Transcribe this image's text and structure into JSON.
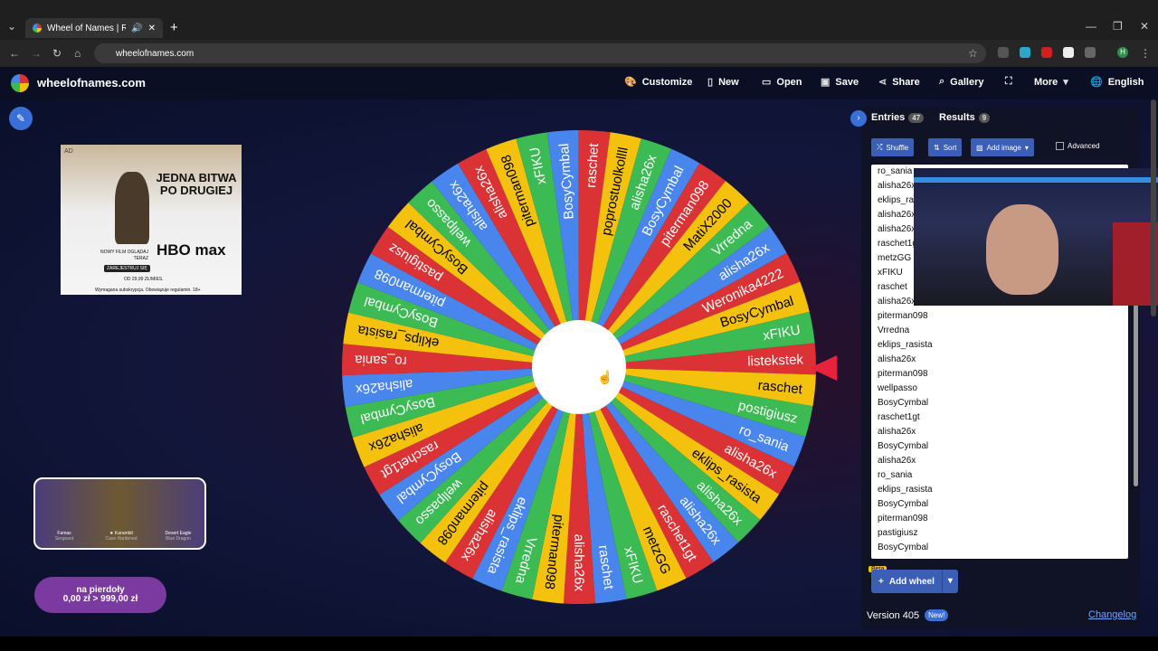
{
  "browser": {
    "tab_title": "Wheel of Names | Random",
    "new_tab_icon": "+",
    "url": "wheelofnames.com",
    "profile_initial": "H"
  },
  "site": {
    "name": "wheelofnames.com",
    "nav": {
      "customize": "Customize",
      "new": "New",
      "open": "Open",
      "save": "Save",
      "share": "Share",
      "gallery": "Gallery",
      "more": "More",
      "language": "English"
    }
  },
  "ad": {
    "label": "AD",
    "title": "JEDNA BITWA PO DRUGIEJ",
    "film_line": "NOWY FILM OGLĄDAJ TERAZ",
    "brand": "HBO max",
    "button": "ZAREJESTRUJ SIĘ",
    "price": "OD 29,99 ZŁ/MIES.",
    "footer": "Wymagana subskrypcja. Obowiązuje regulamin. 18+"
  },
  "skin_panel": {
    "items": [
      {
        "name": "Famas",
        "sub": "Sergeant"
      },
      {
        "name": "★ Karambit",
        "sub": "Case Hardened"
      },
      {
        "name": "Desert Eagle",
        "sub": "Blue Dragon"
      }
    ]
  },
  "price_box": {
    "line1": "na pierdoły",
    "line2": "0,00 zł > 999,00 zł"
  },
  "wheel": {
    "colors": [
      "#db3236",
      "#f4c20d",
      "#3cba54",
      "#4885ed"
    ],
    "winner_label": "listekstek",
    "segments": [
      "listekstek",
      "raschet",
      "postigiusz",
      "ro_sania",
      "alisha26x",
      "eklips_rasista",
      "alisha26x",
      "alisha26x",
      "raschet1gt",
      "metzGG",
      "xFIKU",
      "raschet",
      "alisha26x",
      "piterman098",
      "Vrredna",
      "eklips_rasista",
      "alisha26x",
      "piterman098",
      "wellpasso",
      "BosyCymbal",
      "raschet1gt",
      "alisha26x",
      "BosyCymbal",
      "alisha26x",
      "ro_sania",
      "eklips_rasista",
      "BosyCymbal",
      "piterman098",
      "pastigiusz",
      "BosyCymbal",
      "wellpasso",
      "alisha26x",
      "alisha26x",
      "piterman098",
      "xFIKU",
      "BosyCymbal",
      "raschet",
      "poprostuolkollll",
      "alisha26x",
      "BosyCymbal",
      "piterman098",
      "MatiX2000",
      "Vrredna",
      "alisha26x",
      "Weronika4222",
      "BosyCymbal",
      "xFIKU"
    ]
  },
  "panel": {
    "entries_tab": "Entries",
    "entries_count": "47",
    "results_tab": "Results",
    "results_count": "9",
    "shuffle": "Shuffle",
    "sort": "Sort",
    "add_image": "Add image",
    "advanced": "Advanced",
    "entries": [
      "ro_sania",
      "alisha26x",
      "eklips_rasista",
      "alisha26x",
      "alisha26x",
      "raschet1gt",
      "metzGG",
      "xFIKU",
      "raschet",
      "alisha26x",
      "piterman098",
      "Vrredna",
      "eklips_rasista",
      "alisha26x",
      "piterman098",
      "wellpasso",
      "BosyCymbal",
      "raschet1gt",
      "alisha26x",
      "BosyCymbal",
      "alisha26x",
      "ro_sania",
      "eklips_rasista",
      "BosyCymbal",
      "piterman098",
      "pastigiusz",
      "BosyCymbal"
    ],
    "beta": "Beta",
    "add_wheel": "Add wheel",
    "version": "Version 405",
    "new_badge": "New!",
    "changelog": "Changelog"
  }
}
